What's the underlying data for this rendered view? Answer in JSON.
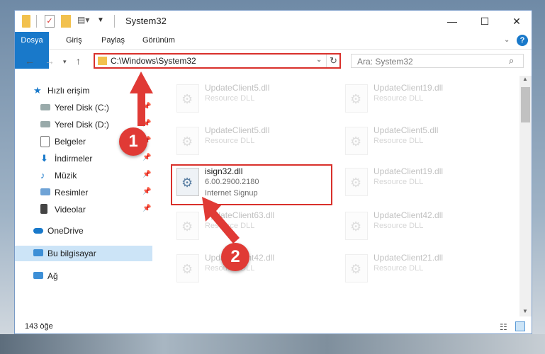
{
  "window": {
    "title": "System32",
    "minimize": "—",
    "maximize": "☐",
    "close": "✕"
  },
  "ribbon": {
    "tabs": [
      "Dosya",
      "Giriş",
      "Paylaş",
      "Görünüm"
    ]
  },
  "nav": {
    "address": "C:\\Windows\\System32",
    "search_placeholder": "Ara: System32"
  },
  "sidebar": {
    "items": [
      {
        "label": "Hızlı erişim",
        "icon": "star-icon",
        "pinned": false
      },
      {
        "label": "Yerel Disk (C:)",
        "icon": "drive-icon",
        "pinned": true
      },
      {
        "label": "Yerel Disk (D:)",
        "icon": "drive-icon",
        "pinned": true
      },
      {
        "label": "Belgeler",
        "icon": "document-icon",
        "pinned": true
      },
      {
        "label": "İndirmeler",
        "icon": "download-icon",
        "pinned": true
      },
      {
        "label": "Müzik",
        "icon": "music-icon",
        "pinned": true
      },
      {
        "label": "Resimler",
        "icon": "pictures-icon",
        "pinned": true
      },
      {
        "label": "Videolar",
        "icon": "video-icon",
        "pinned": true
      },
      {
        "label": "OneDrive",
        "icon": "cloud-icon",
        "pinned": false
      },
      {
        "label": "Bu bilgisayar",
        "icon": "computer-icon",
        "pinned": false
      },
      {
        "label": "Ağ",
        "icon": "network-icon",
        "pinned": false
      }
    ]
  },
  "files": [
    {
      "name": "UpdateClient5.dll",
      "desc": "Resource DLL"
    },
    {
      "name": "UpdateClient19.dll",
      "desc": "Resource DLL"
    },
    {
      "name": "UpdateClient5.dll",
      "desc": "Resource DLL"
    },
    {
      "name": "UpdateClient5.dll",
      "desc": "Resource DLL"
    },
    {
      "name": "isign32.dll",
      "version": "6.00.2900.2180",
      "desc": "Internet Signup"
    },
    {
      "name": "UpdateClient19.dll",
      "desc": "Resource DLL"
    },
    {
      "name": "UpdateClient63.dll",
      "desc": "Resource DLL"
    },
    {
      "name": "UpdateClient42.dll",
      "desc": "Resource DLL"
    },
    {
      "name": "UpdateClient42.dll",
      "desc": "Resource DLL"
    },
    {
      "name": "UpdateClient21.dll",
      "desc": "Resource DLL"
    }
  ],
  "status": {
    "count": "143 öğe"
  },
  "callouts": {
    "one": "1",
    "two": "2"
  },
  "colors": {
    "accent": "#1979ca",
    "highlight": "#d9302b",
    "selection": "#cce4f7"
  }
}
